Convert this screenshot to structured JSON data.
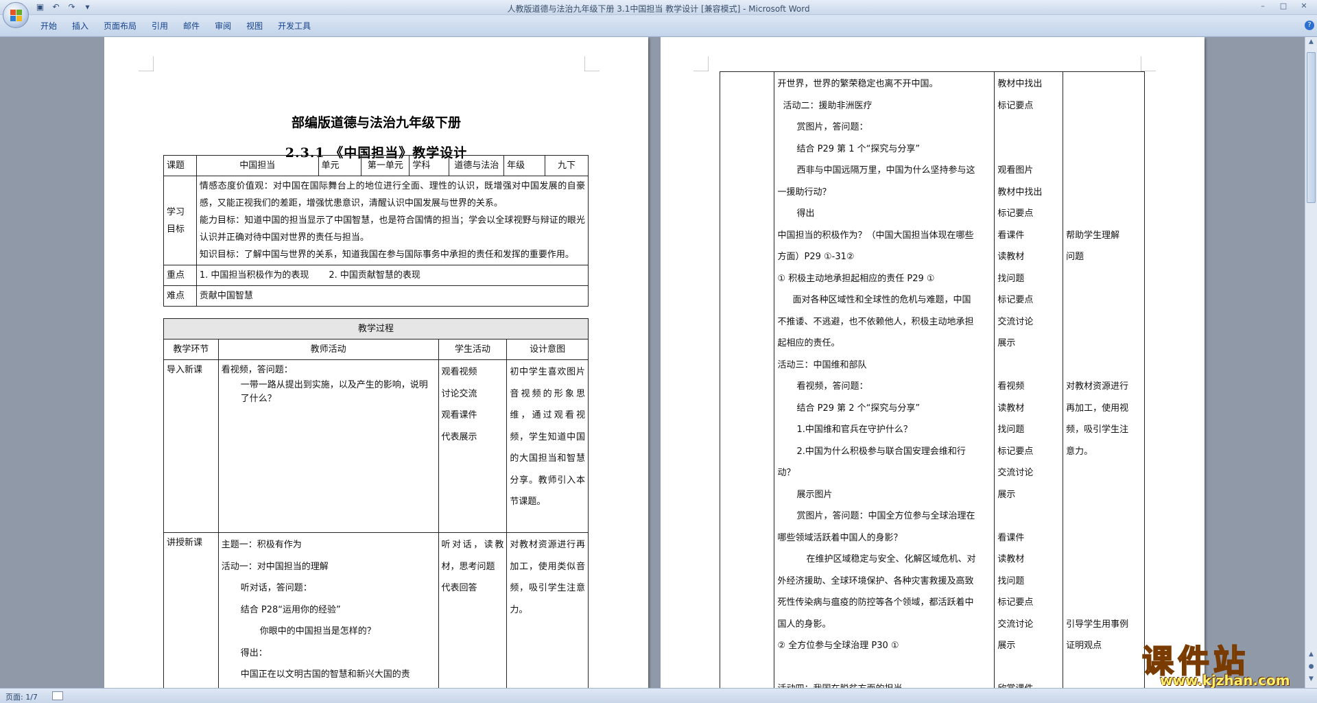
{
  "window": {
    "title": "人教版道德与法治九年级下册 3.1中国担当 教学设计 [兼容模式] - Microsoft Word",
    "qat": [
      "save-icon",
      "undo-icon",
      "redo-icon",
      "customize-icon"
    ]
  },
  "ribbon": {
    "tabs": [
      "开始",
      "插入",
      "页面布局",
      "引用",
      "邮件",
      "审阅",
      "视图",
      "开发工具"
    ]
  },
  "doc": {
    "title": "部编版道德与法治九年级下册",
    "subtitle": "2.3.1 《中国担当》教学设计",
    "info": {
      "k_topic": "课题",
      "topic": "中国担当",
      "k_unit": "单元",
      "unit": "第一单元",
      "k_subject": "学科",
      "subject": "道德与法治",
      "k_grade": "年级",
      "grade": "九下"
    },
    "goals": {
      "label": "学习目标",
      "emotion": "情感态度价值观：对中国在国际舞台上的地位进行全面、理性的认识，既增强对中国发展的自豪感，又能正视我们的差距，增强忧患意识，清醒认识中国发展与世界的关系。",
      "ability": "能力目标：知道中国的担当显示了中国智慧，也是符合国情的担当；学会以全球视野与辩证的眼光认识并正确对待中国对世界的责任与担当。",
      "knowledge": "知识目标：了解中国与世界的关系，知道我国在参与国际事务中承担的责任和发挥的重要作用。"
    },
    "focus": {
      "label": "重点",
      "text": "1. 中国担当积极作为的表现       2. 中国贡献智慧的表现"
    },
    "difficulty": {
      "label": "难点",
      "text": "贡献中国智慧"
    },
    "process": {
      "title": "教学过程",
      "headers": [
        "教学环节",
        "教师活动",
        "学生活动",
        "设计意图"
      ],
      "intro": {
        "stage": "导入新课",
        "teacher": [
          "看视频，答问题：",
          "一带一路从提出到实施，以及产生的影响，说明了什么？"
        ],
        "student": [
          "观看视频",
          "讨论交流",
          "观看课件",
          "代表展示"
        ],
        "intent": "初中学生喜欢图片音视频的形象思维，通过观看视频，学生知道中国的大国担当和智慧分享。教师引入本节课题。"
      },
      "lecture": {
        "stage": "讲授新课",
        "teacher": [
          "主题一：积极有作为",
          "活动一：对中国担当的理解",
          "听对话，答问题：",
          "结合 P28“运用你的经验”",
          "你眼中的中国担当是怎样的？",
          "得出：",
          "中国正在以文明古国的智慧和新兴大国的责"
        ],
        "student": [
          "听对话，读教材，思考问题",
          "代表回答"
        ],
        "intent": "对教材资源进行再加工，使用类似音频，吸引学生注意力。"
      }
    },
    "right_page": {
      "teacher": [
        "开世界，世界的繁荣稳定也离不开中国。",
        "活动二：援助非洲医疗",
        "赏图片，答问题：",
        "结合 P29 第 1 个“探究与分享”",
        "西非与中国远隔万里，中国为什么坚持参与这",
        "一援助行动？",
        "得出",
        "中国担当的积极作为？（中国大国担当体现在哪些",
        "方面）P29 ①-31②",
        "①  积极主动地承担起相应的责任    P29  ①",
        "面对各种区域性和全球性的危机与难题，中国",
        "不推诿、不逃避，也不依赖他人，积极主动地承担",
        "起相应的责任。",
        "活动三：中国维和部队",
        "看视频，答问题：",
        "结合 P29 第 2 个“探究与分享”",
        "1.中国维和官兵在守护什么？",
        "2.中国为什么积极参与联合国安理会维和行",
        "动？",
        "展示图片",
        "赏图片，答问题：中国全方位参与全球治理在",
        "哪些领域活跃着中国人的身影？",
        "在维护区域稳定与安全、化解区域危机、对",
        "外经济援助、全球环境保护、各种灾害救援及高致",
        "死性传染病与瘟疫的防控等各个领域，都活跃着中",
        "国人的身影。",
        "②  全方位参与全球治理    P30  ①",
        "",
        "活动四：我国在脱贫方面的担当"
      ],
      "student": [
        "教材中找出",
        "标记要点",
        "",
        "",
        "观看图片",
        "教材中找出",
        "标记要点",
        "看课件",
        "读教材",
        "找问题",
        "标记要点",
        "交流讨论",
        "展示",
        "",
        "看视频",
        "读教材",
        "找问题",
        "标记要点",
        "交流讨论",
        "展示",
        "",
        "看课件",
        "读教材",
        "找问题",
        "标记要点",
        "交流讨论",
        "展示",
        "",
        "欣赏课件"
      ],
      "intent": [
        "",
        "",
        "",
        "",
        "",
        "",
        "",
        "帮助学生理解",
        "问题",
        "",
        "",
        "",
        "",
        "",
        "对教材资源进行",
        "再加工，使用视",
        "频，吸引学生注",
        "意力。",
        "",
        "",
        "",
        "",
        "",
        "",
        "",
        "引导学生用事例",
        "证明观点",
        "",
        ""
      ]
    }
  },
  "status": {
    "page": "页面: 1/7"
  },
  "watermark": {
    "brand": "课件站",
    "url": "www.kjzhan.com"
  }
}
